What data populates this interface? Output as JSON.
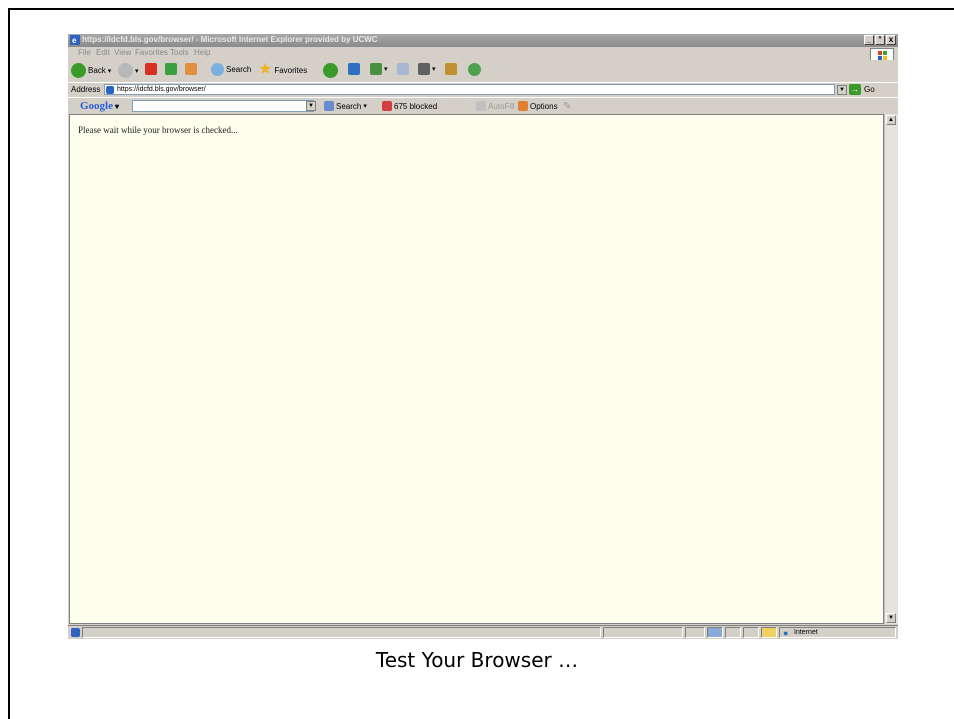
{
  "window": {
    "title": "https://idcfd.bls.gov/browser/ - Microsoft Internet Explorer provided by UCWC",
    "controls": [
      "_",
      "°",
      "x"
    ]
  },
  "menu": [
    "File",
    "Edit",
    "View",
    "Favorites",
    "Tools",
    "Help"
  ],
  "toolbar": {
    "back_label": "Back",
    "search_label": "Search",
    "favorites_label": "Favorites"
  },
  "address": {
    "label": "Address",
    "url": "https://idcfd.bls.gov/browser/",
    "go_label": "Go"
  },
  "google_bar": {
    "logo": "Google",
    "search_label": "Search",
    "blocked_label": "675 blocked",
    "autofill_label": "AutoFill",
    "options_label": "Options"
  },
  "content": {
    "message": "Please wait while your browser is checked..."
  },
  "statusbar": {
    "zone_label": "Internet"
  },
  "caption": "Test Your Browser …"
}
